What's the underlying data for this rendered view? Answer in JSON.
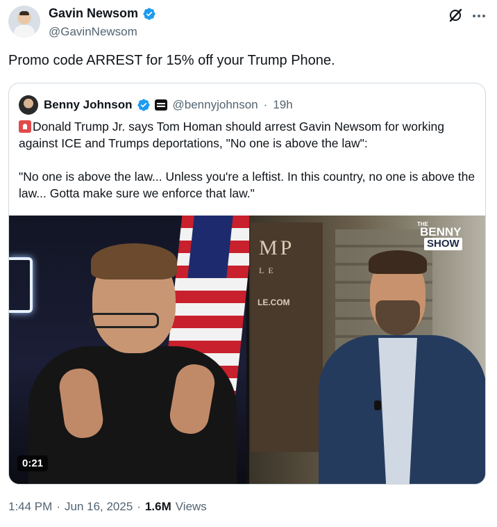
{
  "author": {
    "name": "Gavin Newsom",
    "handle": "@GavinNewsom",
    "verified": true
  },
  "tweet": {
    "text": "Promo code ARREST for 15% off your Trump Phone.",
    "time": "1:44 PM",
    "date": "Jun 16, 2025",
    "separator": "·",
    "views_count": "1.6M",
    "views_label": "Views"
  },
  "quoted": {
    "name": "Benny Johnson",
    "handle": "@bennyjohnson",
    "separator": "·",
    "time": "19h",
    "paragraph1": "Donald Trump Jr. says Tom Homan should arrest Gavin Newsom for working against ICE and Trumps deportations, \"No one is above the law\":",
    "paragraph2": "\"No one is above the law... Unless you're a leftist. In this country, no one is above the law... Gotta make sure we enforce that law.\""
  },
  "video": {
    "duration": "0:21",
    "logo_the": "THE",
    "logo_line1": "BENNY",
    "logo_line2": "SHOW",
    "poster_text": "MP",
    "poster_sub": "LE",
    "poster_url": "LE.COM"
  },
  "colors": {
    "verified_blue": "#1d9bf0",
    "secondary_text": "#536471",
    "primary_text": "#0f1419",
    "border": "#cfd9de"
  },
  "icons": [
    "verified-badge-icon",
    "grok-icon",
    "more-icon",
    "siren-emoji-icon",
    "affiliation-badge-icon"
  ]
}
